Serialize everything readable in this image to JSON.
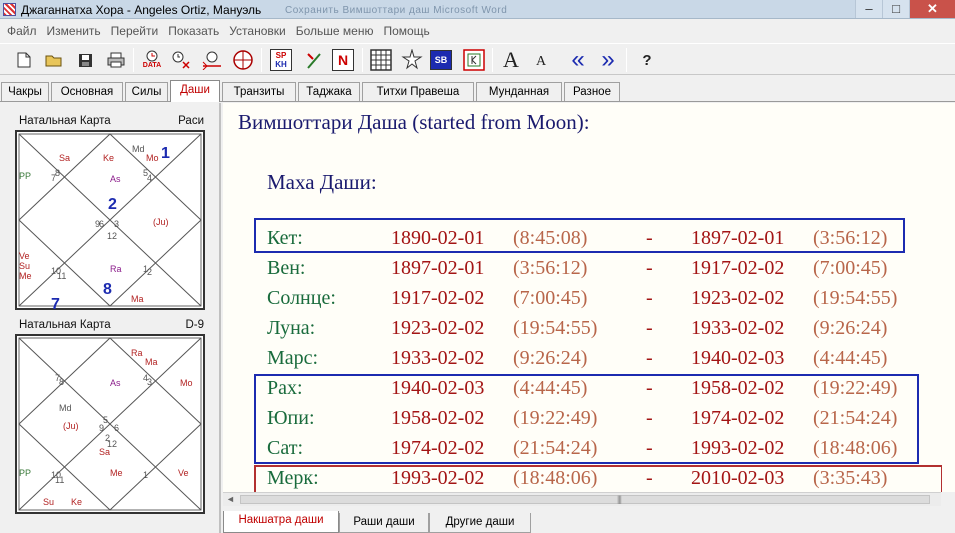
{
  "window": {
    "title": "Джаганнатха Хора - Angeles Ortiz, Мануэль",
    "ghost_title": "Сохранить Вимшоттари даш     Microsoft Word",
    "minimize": "–",
    "maximize": "□",
    "close": "✕"
  },
  "menu": [
    "Файл",
    "Изменить",
    "Перейти",
    "Показать",
    "Установки",
    "Больше меню",
    "Помощь"
  ],
  "toolbar": {
    "data_label": "DATA",
    "sp_label": "SP",
    "kh_label": "KH",
    "n_label": "N",
    "sb_label": "SB",
    "big_a": "A",
    "small_a": "A",
    "prev": "«",
    "next": "»",
    "help": "?"
  },
  "tabs": [
    {
      "label": "Чакры",
      "active": false
    },
    {
      "label": "Основная",
      "active": false
    },
    {
      "label": "Силы",
      "active": false
    },
    {
      "label": "Даши",
      "active": true
    },
    {
      "label": "Транзиты",
      "active": false
    },
    {
      "label": "Таджака",
      "active": false
    },
    {
      "label": "Титхи Правеша",
      "active": false
    },
    {
      "label": "Мунданная",
      "active": false
    },
    {
      "label": "Разное",
      "active": false
    }
  ],
  "charts": [
    {
      "title": "Натальная Карта",
      "varga": "Раси",
      "labels": [
        {
          "t": "Sa",
          "c": "#b22222"
        },
        {
          "t": "Ke",
          "c": "#b22222"
        },
        {
          "t": "Md",
          "c": "#555555"
        },
        {
          "t": "Mo",
          "c": "#b22222"
        },
        {
          "t": "1",
          "c": "#1c2bb0",
          "big": true
        },
        {
          "t": "PP",
          "c": "#3b7a3b"
        },
        {
          "t": "8",
          "c": "#555555"
        },
        {
          "t": "7",
          "c": "#555555"
        },
        {
          "t": "As",
          "c": "#8b1c8b"
        },
        {
          "t": "5",
          "c": "#555555"
        },
        {
          "t": "4",
          "c": "#555555"
        },
        {
          "t": "2",
          "c": "#1c2bb0",
          "big": true
        },
        {
          "t": "6",
          "c": "#555555"
        },
        {
          "t": "9",
          "c": "#555555"
        },
        {
          "t": "3",
          "c": "#555555"
        },
        {
          "t": "(Ju)",
          "c": "#b22222"
        },
        {
          "t": "12",
          "c": "#555555"
        },
        {
          "t": "Ve",
          "c": "#b22222"
        },
        {
          "t": "Su",
          "c": "#b22222"
        },
        {
          "t": "Me",
          "c": "#b22222"
        },
        {
          "t": "10",
          "c": "#555555"
        },
        {
          "t": "11",
          "c": "#555555"
        },
        {
          "t": "Ra",
          "c": "#8b1c8b"
        },
        {
          "t": "8",
          "c": "#1c2bb0",
          "big": true
        },
        {
          "t": "1",
          "c": "#555555"
        },
        {
          "t": "2",
          "c": "#555555"
        },
        {
          "t": "7",
          "c": "#1c2bb0",
          "big": true
        },
        {
          "t": "Ma",
          "c": "#b22222"
        }
      ]
    },
    {
      "title": "Натальная Карта",
      "varga": "D-9",
      "labels": [
        {
          "t": "Ra",
          "c": "#b22222"
        },
        {
          "t": "Ma",
          "c": "#b22222"
        },
        {
          "t": "7",
          "c": "#555555"
        },
        {
          "t": "8",
          "c": "#555555"
        },
        {
          "t": "As",
          "c": "#8b1c8b"
        },
        {
          "t": "4",
          "c": "#555555"
        },
        {
          "t": "3",
          "c": "#555555"
        },
        {
          "t": "Mo",
          "c": "#b22222"
        },
        {
          "t": "Md",
          "c": "#555555"
        },
        {
          "t": "(Ju)",
          "c": "#b22222"
        },
        {
          "t": "5",
          "c": "#555555"
        },
        {
          "t": "9",
          "c": "#555555"
        },
        {
          "t": "6",
          "c": "#555555"
        },
        {
          "t": "2",
          "c": "#555555"
        },
        {
          "t": "12",
          "c": "#555555"
        },
        {
          "t": "Sa",
          "c": "#b22222"
        },
        {
          "t": "PP",
          "c": "#3b7a3b"
        },
        {
          "t": "10",
          "c": "#555555"
        },
        {
          "t": "Me",
          "c": "#b22222"
        },
        {
          "t": "Ve",
          "c": "#b22222"
        },
        {
          "t": "11",
          "c": "#555555"
        },
        {
          "t": "1",
          "c": "#555555"
        },
        {
          "t": "Su",
          "c": "#b22222"
        },
        {
          "t": "Ke",
          "c": "#b22222"
        }
      ]
    }
  ],
  "dasha": {
    "title": "Вимшоттари Даша  (started from Moon):",
    "section": "Маха Даши:",
    "dash": "-",
    "rows": [
      {
        "planet": "Кет:",
        "start_date": "1890-02-01",
        "start_time": "(8:45:08)",
        "end_date": "1897-02-01",
        "end_time": "(3:56:12)"
      },
      {
        "planet": "Вен:",
        "start_date": "1897-02-01",
        "start_time": "(3:56:12)",
        "end_date": "1917-02-02",
        "end_time": "(7:00:45)"
      },
      {
        "planet": "Солнце:",
        "start_date": "1917-02-02",
        "start_time": "(7:00:45)",
        "end_date": "1923-02-02",
        "end_time": "(19:54:55)"
      },
      {
        "planet": "Луна:",
        "start_date": "1923-02-02",
        "start_time": "(19:54:55)",
        "end_date": "1933-02-02",
        "end_time": "(9:26:24)"
      },
      {
        "planet": "Марс:",
        "start_date": "1933-02-02",
        "start_time": "(9:26:24)",
        "end_date": "1940-02-03",
        "end_time": "(4:44:45)"
      },
      {
        "planet": "Рах:",
        "start_date": "1940-02-03",
        "start_time": "(4:44:45)",
        "end_date": "1958-02-02",
        "end_time": "(19:22:49)"
      },
      {
        "planet": "Юпи:",
        "start_date": "1958-02-02",
        "start_time": "(19:22:49)",
        "end_date": "1974-02-02",
        "end_time": "(21:54:24)"
      },
      {
        "planet": "Сат:",
        "start_date": "1974-02-02",
        "start_time": "(21:54:24)",
        "end_date": "1993-02-02",
        "end_time": "(18:48:06)"
      },
      {
        "planet": "Мерк:",
        "start_date": "1993-02-02",
        "start_time": "(18:48:06)",
        "end_date": "2010-02-03",
        "end_time": "(3:35:43)"
      }
    ]
  },
  "scrollbar": {
    "left_arrow": "◄",
    "grip": "|||"
  },
  "bottom_tabs": [
    {
      "label": "Накшатра даши",
      "active": true
    },
    {
      "label": "Раши даши",
      "active": false
    },
    {
      "label": "Другие даши",
      "active": false
    }
  ]
}
